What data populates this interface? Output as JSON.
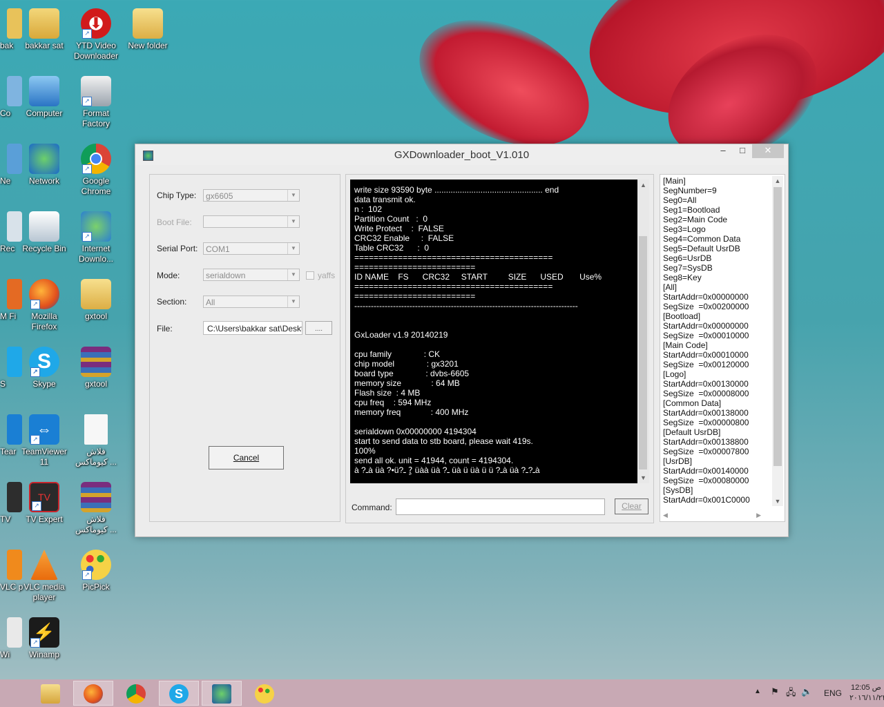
{
  "desktop": {
    "partial_icons": [
      "bak",
      "Co",
      "Ne",
      "Rec",
      "M Fi",
      "S",
      "Tear",
      "TV",
      "VLC p",
      "Wi"
    ],
    "col1": [
      "bakkar sat",
      "Computer",
      "Network",
      "Recycle Bin",
      "Mozilla Firefox",
      "Skype",
      "TeamViewer 11",
      "TV Expert",
      "VLC media player",
      "Winamp"
    ],
    "col2": [
      "YTD Video Downloader",
      "Format Factory",
      "Google Chrome",
      "Internet Downlo...",
      "gxtool",
      "gxtool",
      "فلاش كيوماكس ...",
      "فلاش كيوماكس ...",
      "PicPick"
    ],
    "col3": [
      "New folder"
    ]
  },
  "window": {
    "title": "GXDownloader_boot_V1.010",
    "minimize": "–",
    "maximize": "□",
    "close": "✕",
    "left": {
      "chip_type_label": "Chip Type:",
      "chip_type_value": "gx6605",
      "boot_file_label": "Boot File:",
      "boot_file_value": "",
      "serial_port_label": "Serial Port:",
      "serial_port_value": "COM1",
      "mode_label": "Mode:",
      "mode_value": "serialdown",
      "yaffs_label": "yaffs",
      "section_label": "Section:",
      "section_value": "All",
      "file_label": "File:",
      "file_value": "C:\\Users\\bakkar sat\\Deskt",
      "browse_label": "....",
      "cancel_label": "Cancel"
    },
    "console": {
      "lines": [
        "write size 93590 byte ............................................... end",
        "data transmit ok.",
        "n :  102",
        "Partition Count   :  0",
        "Write Protect    :  FALSE",
        "CRC32 Enable     :  FALSE",
        "Table CRC32      :  0",
        "=========================================",
        "=========================",
        "ID NAME    FS      CRC32     START         SIZE      USED       Use%",
        "=========================================",
        "=========================",
        "---------------------------------------------------------------------------------",
        "",
        "",
        "GxLoader v1.9 20140219",
        "",
        "cpu family              : CK",
        "chip model              : gx3201",
        "board type              : dvbs-6605",
        "memory size             : 64 MB",
        "Flash size  : 4 MB",
        "cpu freq    : 594 MHz",
        "memory freq             : 400 MHz",
        "",
        "serialdown 0x00000000 4194304",
        "start to send data to stb board, please wait 419s.",
        "100%",
        "send all ok. unit = 41944, count = 4194304.",
        "à ?ـà üà ?•ü?ـ ?ٍ üàà üà ?ـ üà ü üà ü ü ?ـà üà ?ـ?ـà"
      ],
      "command_label": "Command:",
      "command_value": "",
      "clear_label": "Clear"
    },
    "right": {
      "lines": [
        "[Main]",
        "SegNumber=9",
        "Seg0=All",
        "Seg1=Bootload",
        "Seg2=Main Code",
        "Seg3=Logo",
        "Seg4=Common Data",
        "Seg5=Default UsrDB",
        "Seg6=UsrDB",
        "Seg7=SysDB",
        "Seg8=Key",
        "[All]",
        "StartAddr=0x00000000",
        "SegSize  =0x00200000",
        "[Bootload]",
        "StartAddr=0x00000000",
        "SegSize  =0x00010000",
        "[Main Code]",
        "StartAddr=0x00010000",
        "SegSize  =0x00120000",
        "[Logo]",
        "StartAddr=0x00130000",
        "SegSize  =0x00008000",
        "[Common Data]",
        "StartAddr=0x00138000",
        "SegSize  =0x00000800",
        "[Default UsrDB]",
        "StartAddr=0x00138800",
        "SegSize  =0x00007800",
        "[UsrDB]",
        "StartAddr=0x00140000",
        "SegSize  =0x00080000",
        "[SysDB]",
        "StartAddr=0x001C0000"
      ]
    }
  },
  "taskbar": {
    "apps": [
      "File Explorer",
      "Firefox",
      "Chrome",
      "Skype",
      "GXDownloader",
      "PicPick"
    ],
    "language": "ENG",
    "time": "12:05 ص",
    "date": "٢٠١٦/١١/٢٢"
  },
  "colors": {
    "accent_close": "#c7c7c7",
    "terminal_bg": "#000000",
    "taskbar": "#c8a9b4"
  }
}
